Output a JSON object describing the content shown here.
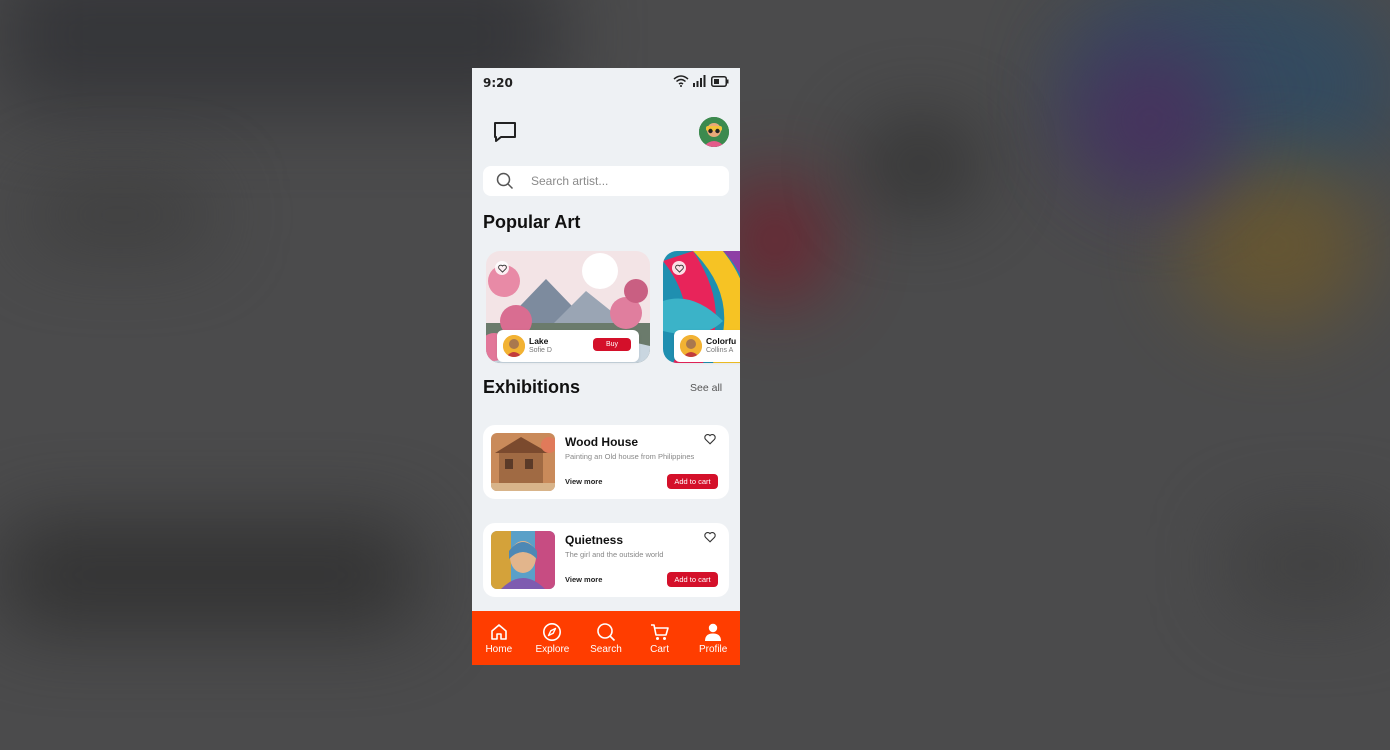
{
  "status_bar": {
    "time": "9:20"
  },
  "search": {
    "placeholder": "Search artist..."
  },
  "popular": {
    "heading": "Popular Art",
    "items": [
      {
        "title": "Lake",
        "artist": "Sofie D",
        "button": "Buy"
      },
      {
        "title": "Colorfu",
        "artist": "Collins A"
      }
    ]
  },
  "exhibitions": {
    "heading": "Exhibitions",
    "see_all": "See all",
    "items": [
      {
        "title": "Wood House",
        "description": "Painting an Old house from Philippines",
        "view_more": "View more",
        "button": "Add to cart"
      },
      {
        "title": "Quietness",
        "description": "The girl and the outside world",
        "view_more": "View more",
        "button": "Add to cart"
      }
    ]
  },
  "tabbar": {
    "items": [
      {
        "label": "Home",
        "icon": "home-icon"
      },
      {
        "label": "Explore",
        "icon": "compass-icon"
      },
      {
        "label": "Search",
        "icon": "search-icon"
      },
      {
        "label": "Cart",
        "icon": "cart-icon"
      },
      {
        "label": "Profile",
        "icon": "profile-icon"
      }
    ]
  },
  "colors": {
    "accent": "#ff3d00",
    "button": "#d4102a",
    "background": "#eef1f4"
  }
}
